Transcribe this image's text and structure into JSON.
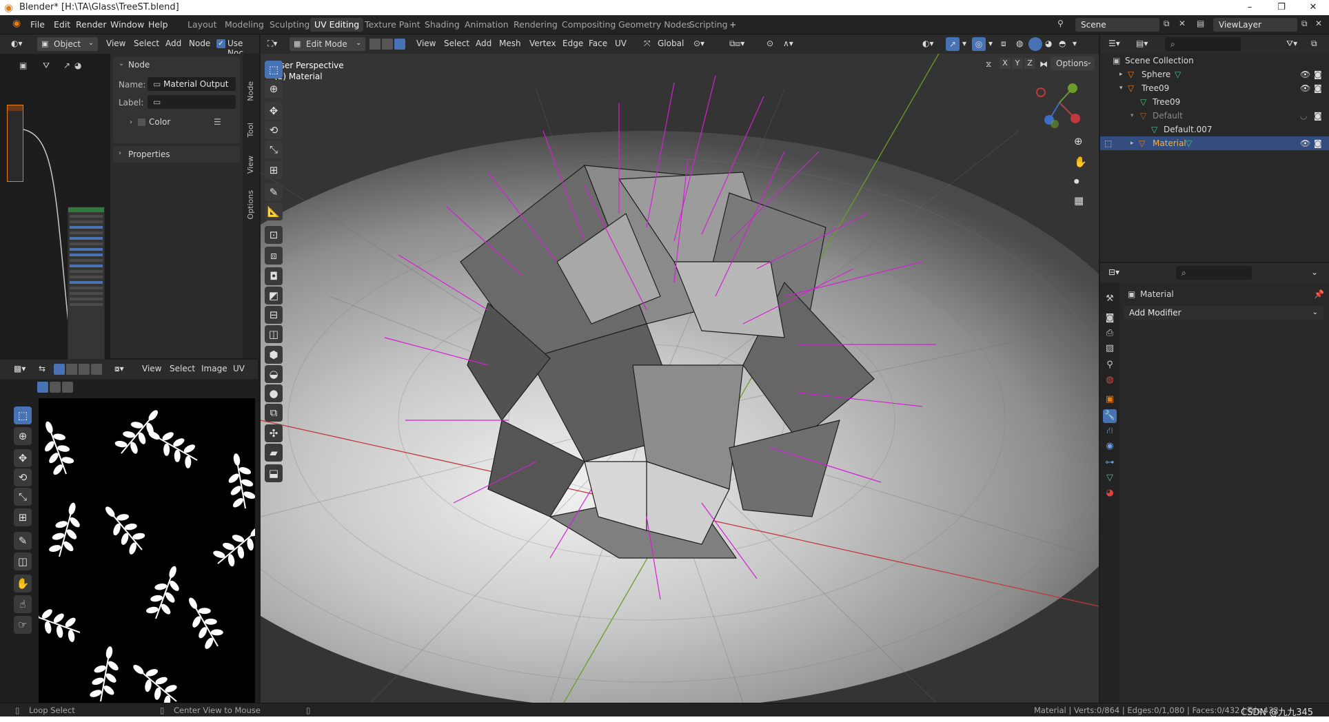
{
  "window": {
    "title": "Blender* [H:\\TA\\Glass\\TreeST.blend]",
    "minimize": "–",
    "maximize": "❐",
    "close": "✕"
  },
  "menu": {
    "items": [
      "File",
      "Edit",
      "Render",
      "Window",
      "Help"
    ]
  },
  "workspaces": {
    "tabs": [
      "Layout",
      "Modeling",
      "Sculpting",
      "UV Editing",
      "Texture Paint",
      "Shading",
      "Animation",
      "Rendering",
      "Compositing",
      "Geometry Nodes",
      "Scripting"
    ],
    "active": "UV Editing",
    "add": "+"
  },
  "scene": {
    "label": "Scene",
    "viewlayer": "ViewLayer"
  },
  "node_editor": {
    "mode": "Object",
    "menu": [
      "View",
      "Select",
      "Add",
      "Node"
    ],
    "use_nodes": "Use Noc"
  },
  "node_panel": {
    "section": "Node",
    "name_label": "Name:",
    "name_value": "Material Output",
    "label_label": "Label:",
    "label_value": "",
    "color_label": "Color",
    "properties_label": "Properties"
  },
  "side_tabs": [
    "Node",
    "Tool",
    "View",
    "Options"
  ],
  "image_editor": {
    "menu": [
      "View",
      "Select",
      "Image",
      "UV"
    ]
  },
  "viewport": {
    "mode": "Edit Mode",
    "menu": [
      "View",
      "Select",
      "Add",
      "Mesh",
      "Vertex",
      "Edge",
      "Face",
      "UV"
    ],
    "transform": "Global",
    "perspective": "User Perspective",
    "object_info": "(1) Material",
    "axes": [
      "X",
      "Y",
      "Z"
    ],
    "options": "Options"
  },
  "outliner": {
    "collection": "Scene Collection",
    "items": [
      {
        "name": "Sphere",
        "level": 1,
        "selected": false
      },
      {
        "name": "Tree09",
        "level": 1,
        "selected": false
      },
      {
        "name": "Tree09",
        "level": 2,
        "selected": false
      },
      {
        "name": "Default",
        "level": 2,
        "selected": false
      },
      {
        "name": "Default.007",
        "level": 3,
        "selected": false
      },
      {
        "name": "Material",
        "level": 1,
        "selected": true
      }
    ]
  },
  "properties": {
    "object": "Material",
    "add_modifier": "Add Modifier"
  },
  "status": {
    "left": "Loop Select",
    "middle": "Center View to Mouse",
    "right": "Material | Verts:0/864 | Edges:0/1,080 | Faces:0/432 | Tris:432",
    "watermark": "CSDN @九九345"
  },
  "colors": {
    "accent": "#4772b3",
    "orange": "#e87d0d",
    "normals": "#d51fd5",
    "x_axis": "#c0393c",
    "y_axis": "#6c9b2b"
  }
}
